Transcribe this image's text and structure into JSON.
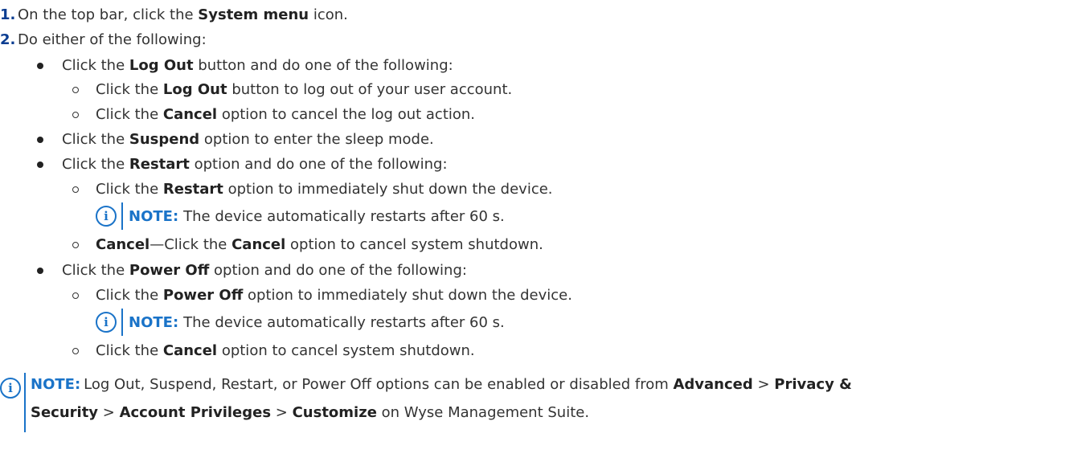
{
  "steps": {
    "s1_num": "1.",
    "s1_pre": "On the top bar, click the ",
    "s1_bold": "System menu",
    "s1_post": " icon.",
    "s2_num": "2.",
    "s2_text": "Do either of the following:"
  },
  "logout": {
    "pre": "Click the ",
    "bold": "Log Out",
    "post": " button and do one of the following:",
    "sub1_pre": "Click the ",
    "sub1_bold": "Log Out",
    "sub1_post": " button to log out of your user account.",
    "sub2_pre": "Click the ",
    "sub2_bold": "Cancel",
    "sub2_post": " option to cancel the log out action."
  },
  "suspend": {
    "pre": "Click the ",
    "bold": "Suspend",
    "post": " option to enter the sleep mode."
  },
  "restart": {
    "pre": "Click the ",
    "bold": "Restart",
    "post": " option and do one of the following:",
    "sub1_pre": "Click the ",
    "sub1_bold": "Restart",
    "sub1_post": " option to immediately shut down the device.",
    "note_label": "NOTE:",
    "note_text": "The device automatically restarts after 60 s.",
    "sub2_bold1": "Cancel",
    "sub2_mid": "—Click the ",
    "sub2_bold2": "Cancel",
    "sub2_post": " option to cancel system shutdown."
  },
  "poweroff": {
    "pre": "Click the ",
    "bold": "Power Off",
    "post": " option and do one of the following:",
    "sub1_pre": "Click the ",
    "sub1_bold": "Power Off",
    "sub1_post": " option to immediately shut down the device.",
    "note_label": "NOTE:",
    "note_text": "The device automatically restarts after 60 s.",
    "sub2_pre": "Click the ",
    "sub2_bold": "Cancel",
    "sub2_post": " option to cancel system shutdown."
  },
  "final_note": {
    "label": "NOTE:",
    "l1_text": "Log Out, Suspend, Restart, or Power Off options can be enabled or disabled from ",
    "l1_b1": "Advanced",
    "l1_sep1": " > ",
    "l1_b2": "Privacy &",
    "l2_b1": "Security",
    "l2_sep1": " > ",
    "l2_b2": "Account Privileges",
    "l2_sep2": " > ",
    "l2_b3": "Customize",
    "l2_post": " on Wyse Management Suite."
  },
  "icons": {
    "info": "i",
    "info_icon_name": "info-circle-icon"
  },
  "colors": {
    "accent": "#1a73c8",
    "number": "#0b3d91"
  }
}
